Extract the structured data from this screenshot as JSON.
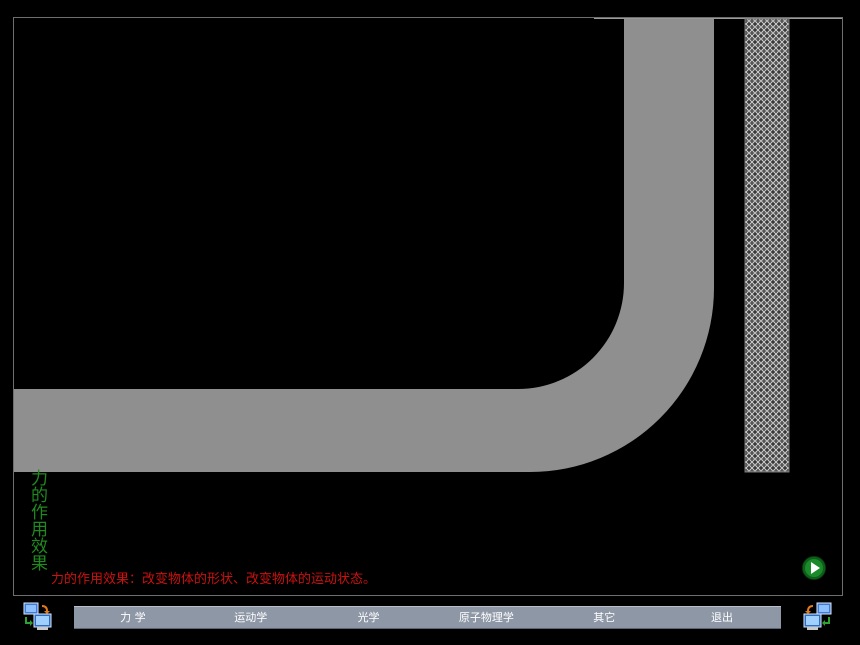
{
  "title_vertical": "力的作用效果",
  "caption": "力的作用效果：改变物体的形状、改变物体的运动状态。",
  "menu": {
    "items": [
      "力 学",
      "运动学",
      "光学",
      "原子物理学",
      "其它",
      "退出"
    ]
  },
  "icons": {
    "play": "play-icon",
    "nav_left": "computer-swap-icon",
    "nav_right": "computer-swap-icon"
  },
  "colors": {
    "background": "#000000",
    "track": "#8f8f8f",
    "title": "#1f8a1f",
    "caption": "#cc1111",
    "menu_bar": "#8e97a6",
    "play": "#1a8a2a"
  }
}
